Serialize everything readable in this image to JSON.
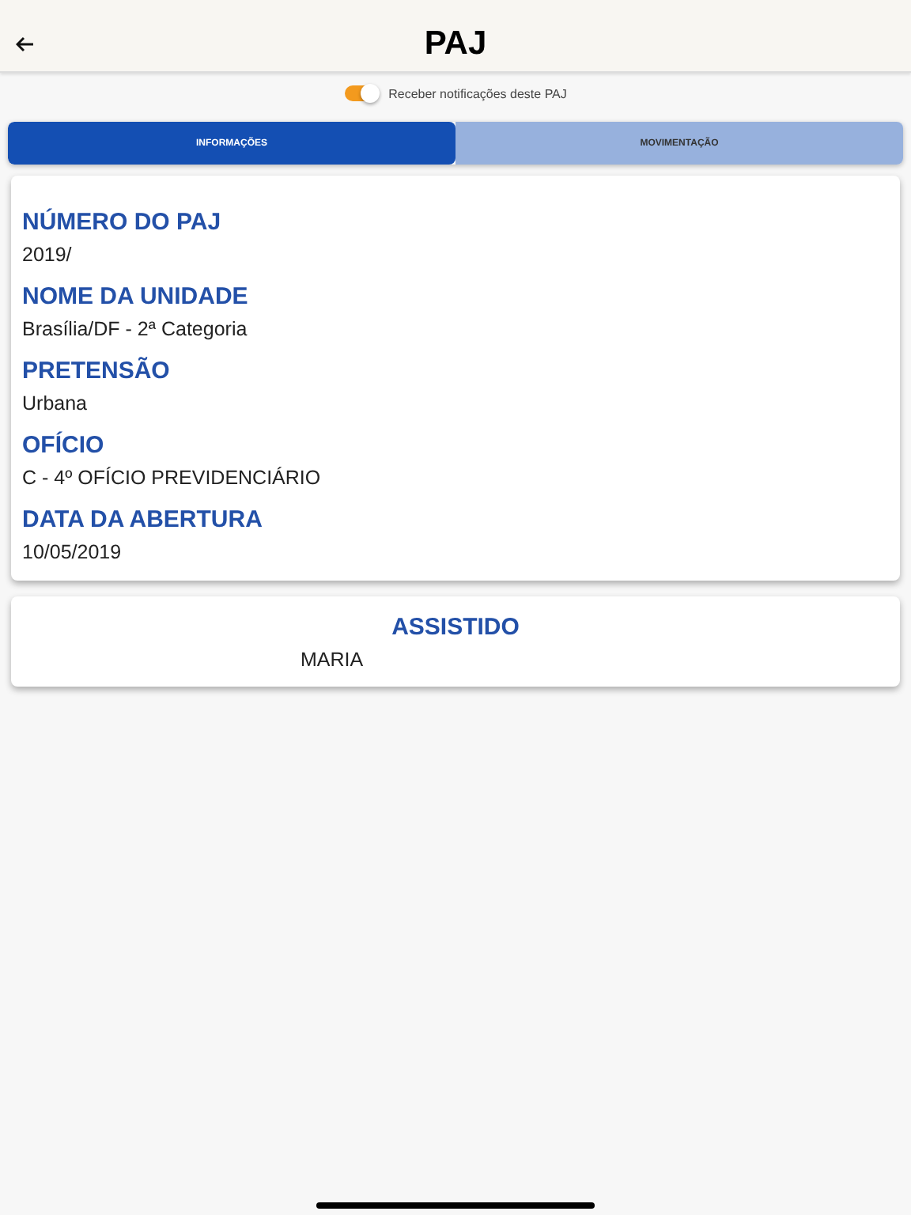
{
  "header": {
    "title": "PAJ"
  },
  "notifications": {
    "label": "Receber notificações deste PAJ",
    "on": true
  },
  "tabs": [
    {
      "label": "INFORMAÇÕES",
      "selected": true
    },
    {
      "label": "MOVIMENTAÇÃO",
      "selected": false
    }
  ],
  "details": [
    {
      "label": "NÚMERO DO PAJ",
      "value": "2019/"
    },
    {
      "label": "NOME DA UNIDADE",
      "value": "Brasília/DF - 2ª Categoria"
    },
    {
      "label": "PRETENSÃO",
      "value": "Urbana"
    },
    {
      "label": "OFÍCIO",
      "value": "C - 4º OFÍCIO PREVIDENCIÁRIO"
    },
    {
      "label": "DATA DA ABERTURA",
      "value": "10/05/2019"
    }
  ],
  "assistido": {
    "title": "ASSISTIDO",
    "name": "MARIA"
  }
}
